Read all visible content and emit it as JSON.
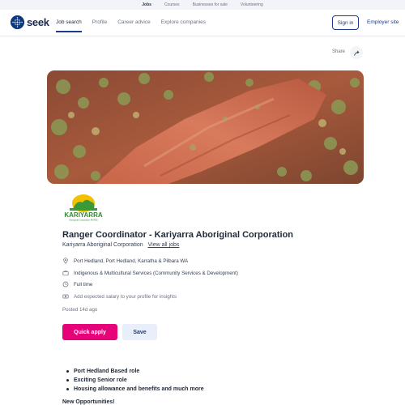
{
  "topbar": {
    "links": [
      {
        "label": "Jobs",
        "active": true
      },
      {
        "label": "Courses",
        "active": false
      },
      {
        "label": "Businesses for sale",
        "active": false
      },
      {
        "label": "Volunteering",
        "active": false
      }
    ]
  },
  "header": {
    "logo_text": "seek",
    "nav": [
      {
        "label": "Job search",
        "active": true
      },
      {
        "label": "Profile",
        "active": false
      },
      {
        "label": "Career advice",
        "active": false
      },
      {
        "label": "Explore companies",
        "active": false
      }
    ],
    "signin_label": "Sign in",
    "employer_label": "Employer site"
  },
  "share_label": "Share",
  "company_logo_text": "KARIYARRA",
  "company_logo_subtext": "Aboriginal Corporation RNTBC",
  "job": {
    "title": "Ranger Coordinator - Kariyarra Aboriginal Corporation",
    "company": "Kariyarra Aboriginal Corporation",
    "view_all": "View all jobs",
    "location": "Port Hedland, Port Hedland, Karratha & Pilbara WA",
    "classification": "Indigenous & Multicultural Services (Community Services & Development)",
    "work_type": "Full time",
    "salary_prompt": "Add expected salary to your profile for insights",
    "posted": "Posted 14d ago"
  },
  "actions": {
    "apply_label": "Quick apply",
    "save_label": "Save"
  },
  "description": {
    "bullets": [
      "Port Hedland Based role",
      "Exciting Senior role",
      "Housing allowance and benefits and much more"
    ],
    "subheading": "New Opportunities!"
  },
  "colors": {
    "brand_navy": "#1e3a8a",
    "apply_pink": "#e60278",
    "save_bg": "#e8effb"
  }
}
